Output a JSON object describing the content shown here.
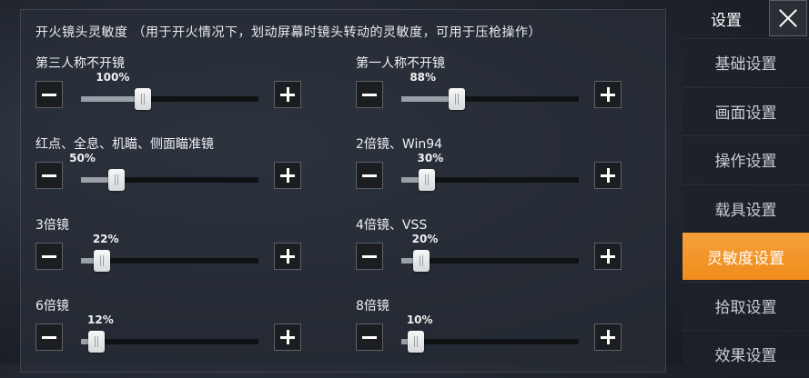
{
  "section": {
    "title": "开火镜头灵敏度 （用于开火情况下，划动屏幕时镜头转动的灵敏度，可用于压枪操作）"
  },
  "controls": [
    {
      "label": "第三人称不开镜",
      "value": 100
    },
    {
      "label": "第一人称不开镜",
      "value": 88
    },
    {
      "label": "红点、全息、机瞄、侧面瞄准镜",
      "value": 50
    },
    {
      "label": "2倍镜、Win94",
      "value": 30
    },
    {
      "label": "3倍镜",
      "value": 22
    },
    {
      "label": "4倍镜、VSS",
      "value": 20
    },
    {
      "label": "6倍镜",
      "value": 12
    },
    {
      "label": "8倍镜",
      "value": 10
    }
  ],
  "percent_suffix": "%",
  "sidebar": {
    "title": "设置",
    "items": [
      {
        "label": "基础设置",
        "active": false
      },
      {
        "label": "画面设置",
        "active": false
      },
      {
        "label": "操作设置",
        "active": false
      },
      {
        "label": "载具设置",
        "active": false
      },
      {
        "label": "灵敏度设置",
        "active": true
      },
      {
        "label": "拾取设置",
        "active": false
      },
      {
        "label": "效果设置",
        "active": false
      }
    ]
  },
  "colors": {
    "accent": "#f08c1c"
  }
}
